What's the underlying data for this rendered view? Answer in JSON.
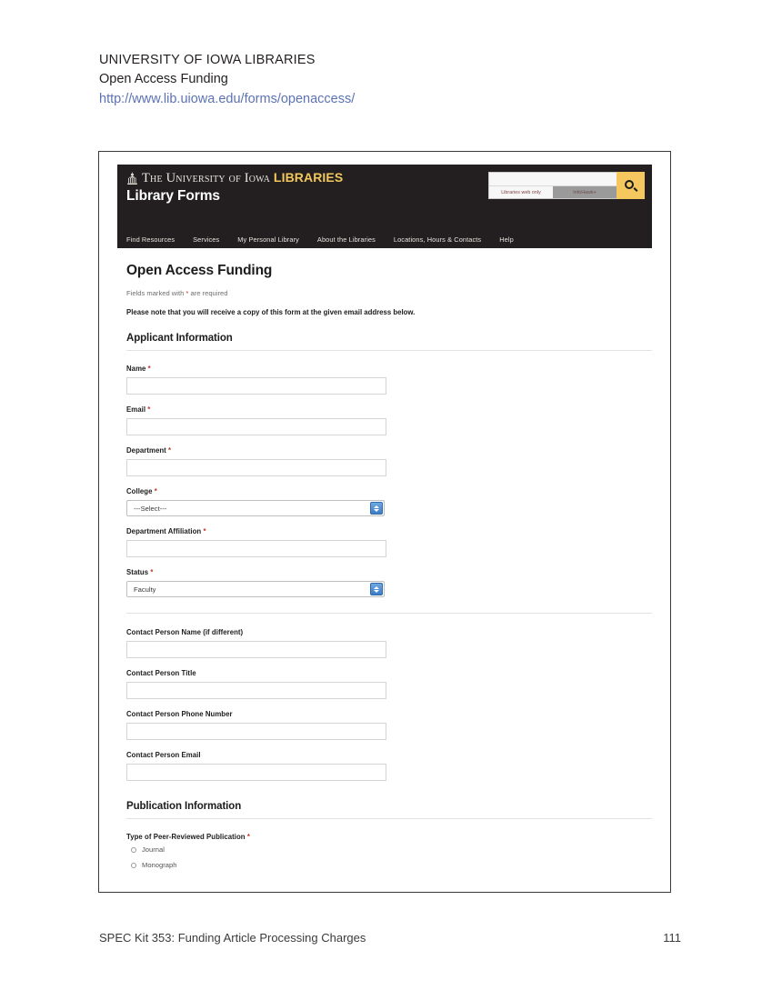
{
  "page_heading": {
    "institution": "UNIVERSITY OF IOWA LIBRARIES",
    "form_name": "Open Access Funding",
    "url": "http://www.lib.uiowa.edu/forms/openaccess/"
  },
  "screenshot": {
    "header": {
      "brand_prefix": "The University of Iowa",
      "brand_suffix": "LIBRARIES",
      "site_title": "Library Forms",
      "oldcap_icon": "oldcapitol-building-icon",
      "search": {
        "input_value": "",
        "tab_web": "Libraries web only",
        "tab_infohawk": "InfoHawk+",
        "button_icon": "search-icon"
      },
      "nav": [
        "Find Resources",
        "Services",
        "My Personal Library",
        "About the Libraries",
        "Locations, Hours & Contacts",
        "Help"
      ]
    },
    "form": {
      "title": "Open Access Funding",
      "required_note_prefix": "Fields marked with ",
      "required_note_star": "*",
      "required_note_suffix": " are required",
      "copy_note": "Please note that you will receive a copy of this form at the given email address below.",
      "sections": [
        {
          "heading": "Applicant Information",
          "fields": [
            {
              "label": "Name",
              "required": true,
              "type": "text",
              "value": ""
            },
            {
              "label": "Email",
              "required": true,
              "type": "text",
              "value": ""
            },
            {
              "label": "Department",
              "required": true,
              "type": "text",
              "value": ""
            },
            {
              "label": "College",
              "required": true,
              "type": "select",
              "value": "---Select---"
            },
            {
              "label": "Department Affiliation",
              "required": true,
              "type": "text",
              "value": ""
            },
            {
              "label": "Status",
              "required": true,
              "type": "select",
              "value": "Faculty"
            }
          ],
          "contact_fields": [
            {
              "label": "Contact Person Name (if different)",
              "required": false,
              "type": "text",
              "value": ""
            },
            {
              "label": "Contact Person Title",
              "required": false,
              "type": "text",
              "value": ""
            },
            {
              "label": "Contact Person Phone Number",
              "required": false,
              "type": "text",
              "value": ""
            },
            {
              "label": "Contact Person Email",
              "required": false,
              "type": "text",
              "value": ""
            }
          ]
        },
        {
          "heading": "Publication Information",
          "radio_group": {
            "label": "Type of Peer-Reviewed Publication",
            "required": true,
            "options": [
              "Journal",
              "Monograph"
            ],
            "selected": null
          }
        }
      ]
    }
  },
  "footer": {
    "text": "SPEC Kit 353: Funding Article Processing Charges",
    "page_number": "111"
  },
  "colors": {
    "header_bg": "#231f20",
    "gold": "#f4c85f",
    "link_blue": "#5b72b5",
    "required_red": "#c0392b",
    "stepper_blue": "#3d7dc4"
  }
}
